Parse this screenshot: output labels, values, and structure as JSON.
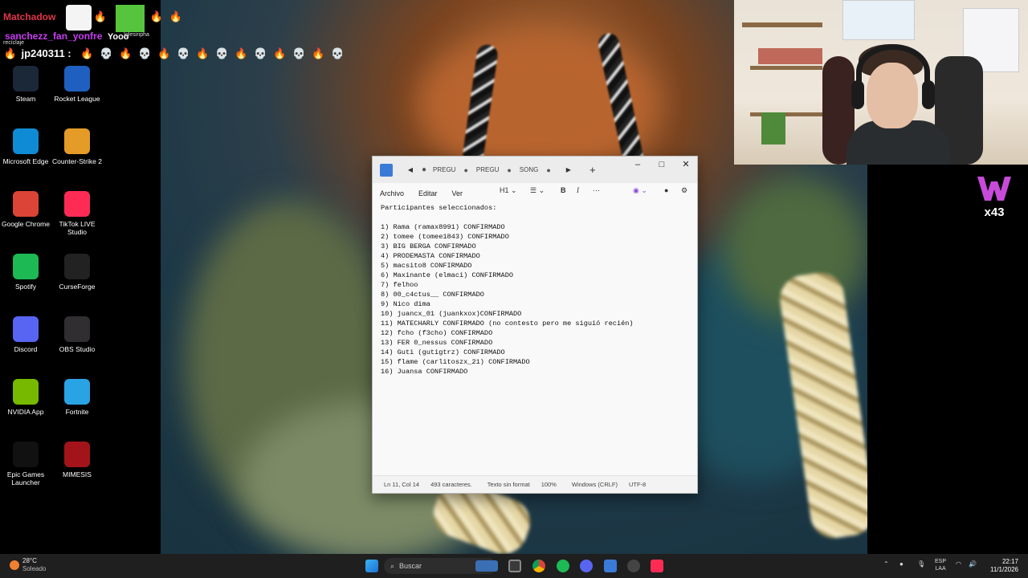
{
  "chat": {
    "line1_name": "Matchadow",
    "line1_user2": "sanchezz_fan_yonfre",
    "line1_text2": "Yooo",
    "line1_small": "recíclaje",
    "line1_small2": "Iglesinpha",
    "line2_name": "jp240311 :",
    "line2_colors": {
      "name1": "#e0354a",
      "name2": "#c93df2",
      "name3": "#ffffff"
    }
  },
  "desktop_icons": [
    {
      "label": "Steam",
      "icon": "steam-icon",
      "color": "#1b2838"
    },
    {
      "label": "Rocket League",
      "icon": "rocket-league-icon",
      "color": "#1f5fbf"
    },
    {
      "label": "Microsoft Edge",
      "icon": "edge-icon",
      "color": "#0f8ad4"
    },
    {
      "label": "Counter-Strike 2",
      "icon": "cs2-icon",
      "color": "#e59b27"
    },
    {
      "label": "Google Chrome",
      "icon": "chrome-icon",
      "color": "#db4437"
    },
    {
      "label": "TikTok LIVE Studio",
      "icon": "tiktok-live-icon",
      "color": "#fe2c55"
    },
    {
      "label": "Spotify",
      "icon": "spotify-icon",
      "color": "#1db954"
    },
    {
      "label": "CurseForge",
      "icon": "curseforge-icon",
      "color": "#222222"
    },
    {
      "label": "Discord",
      "icon": "discord-icon",
      "color": "#5865f2"
    },
    {
      "label": "OBS Studio",
      "icon": "obs-icon",
      "color": "#302e31"
    },
    {
      "label": "NVIDIA App",
      "icon": "nvidia-icon",
      "color": "#76b900"
    },
    {
      "label": "Fortnite",
      "icon": "fortnite-icon",
      "color": "#2aa3e5"
    },
    {
      "label": "Epic Games Launcher",
      "icon": "epic-games-icon",
      "color": "#111111"
    },
    {
      "label": "MIMESIS",
      "icon": "mimesis-icon",
      "color": "#a3141a"
    }
  ],
  "notepad": {
    "tabs": [
      "PREGU",
      "PREGU",
      "SONG"
    ],
    "menu": {
      "file": "Archivo",
      "edit": "Editar",
      "view": "Ver"
    },
    "heading_select": "H1",
    "text_lines": [
      "Participantes seleccionados:",
      "",
      "1) Rama (ramax8991) CONFIRMADO",
      "2) tomee (tomee1843) CONFIRMADO",
      "3) BIG BERGA CONFIRMADO",
      "4) PRODEMASTA CONFIRMADO",
      "5) macsito8 CONFIRMADO",
      "6) Maxinante (elmaci) CONFIRMADO",
      "7) felhoo",
      "8) 00_c4ctus__ CONFIRMADO",
      "9) Nico dima",
      "10) juancx_01 (juankxox)CONFIRMADO",
      "11) MATECHARLY CONFIRMADO (no contesto pero me siguió recién)",
      "12) fcho (f3cho) CONFIRMADO",
      "13) FER 0_nessus CONFIRMADO",
      "14) Guti (gutigtrz) CONFIRMADO",
      "15) flame (carlitoszx_21) CONFIRMADO",
      "16) Juansa CONFIRMADO"
    ],
    "status": {
      "position": "Ln 11, Col 14",
      "chars": "493 caracteres.",
      "format": "Texto sin format",
      "zoom": "100%",
      "line_endings": "Windows (CRLF)",
      "encoding": "UTF-8"
    }
  },
  "overlay": {
    "logo_text": "x43"
  },
  "taskbar": {
    "weather_temp": "28°C",
    "weather_desc": "Soleado",
    "search_placeholder": "Buscar",
    "lang_top": "ESP",
    "lang_bottom": "LAA",
    "time": "22:17",
    "date": "11/1/2026"
  }
}
